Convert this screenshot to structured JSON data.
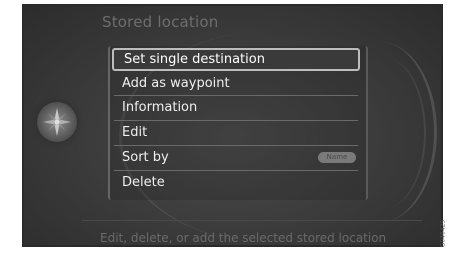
{
  "screen": {
    "title": "Stored location",
    "hint": "Edit, delete, or add the selected stored location"
  },
  "menu": {
    "items": [
      {
        "label": "Set single destination",
        "selected": true
      },
      {
        "label": "Add as waypoint",
        "selected": false
      },
      {
        "label": "Information",
        "selected": false
      },
      {
        "label": "Edit",
        "selected": false
      },
      {
        "label": "Sort by",
        "selected": false
      },
      {
        "label": "Delete",
        "selected": false
      }
    ],
    "sort_value": "Name"
  },
  "icons": {
    "compass": "compass-icon"
  },
  "image_code": "G046429",
  "colors": {
    "screen_bg": "#3a3a3a",
    "text": "#f0f0f0",
    "dim_text": "#6e6e6e",
    "selection_border": "#bdbdbd"
  }
}
